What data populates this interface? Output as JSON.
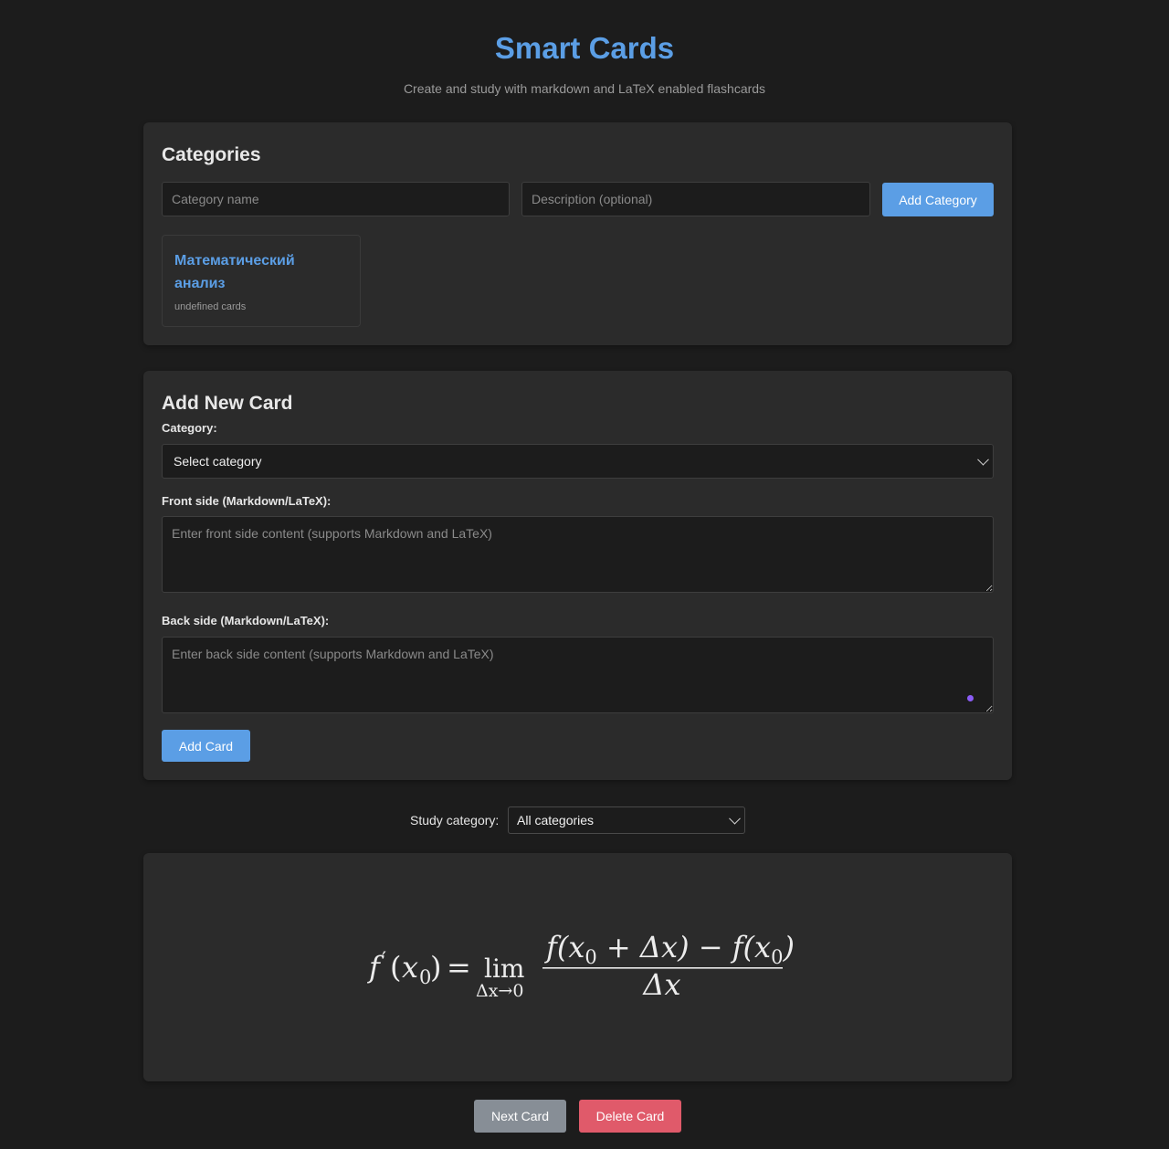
{
  "header": {
    "title": "Smart Cards",
    "subtitle": "Create and study with markdown and LaTeX enabled flashcards"
  },
  "categories_panel": {
    "title": "Categories",
    "name_placeholder": "Category name",
    "description_placeholder": "Description (optional)",
    "add_button": "Add Category",
    "items": [
      {
        "name": "Математический анализ",
        "count_text": "undefined cards"
      }
    ]
  },
  "add_card_panel": {
    "title": "Add New Card",
    "category_label": "Category:",
    "category_select_value": "Select category",
    "front_label": "Front side (Markdown/LaTeX):",
    "front_placeholder": "Enter front side content (supports Markdown and LaTeX)",
    "back_label": "Back side (Markdown/LaTeX):",
    "back_placeholder": "Enter back side content (supports Markdown and LaTeX)",
    "add_button": "Add Card"
  },
  "study": {
    "label": "Study category:",
    "select_value": "All categories"
  },
  "flashcard": {
    "formula_latex": "f'(x_0) = \\lim_{\\Delta x \\to 0} \\frac{f(x_0 + \\Delta x) - f(x_0)}{\\Delta x}",
    "lhs_f": "f",
    "lhs_prime": "′",
    "lhs_open": "(",
    "lhs_x": "x",
    "lhs_sub": "0",
    "lhs_close": ")",
    "equals": "=",
    "lim": "lim",
    "lim_sub": "Δx→0",
    "numerator_1": "f(x",
    "numerator_sub_1": "0",
    "numerator_2": " + Δx) − f(x",
    "numerator_sub_2": "0",
    "numerator_3": ")",
    "denominator": "Δx"
  },
  "actions": {
    "next_button": "Next Card",
    "delete_button": "Delete Card"
  },
  "colors": {
    "accent": "#5b9ee5",
    "background": "#1c1c1c",
    "panel": "#2b2b2b",
    "delete": "#e05a6a",
    "next": "#878e96"
  }
}
